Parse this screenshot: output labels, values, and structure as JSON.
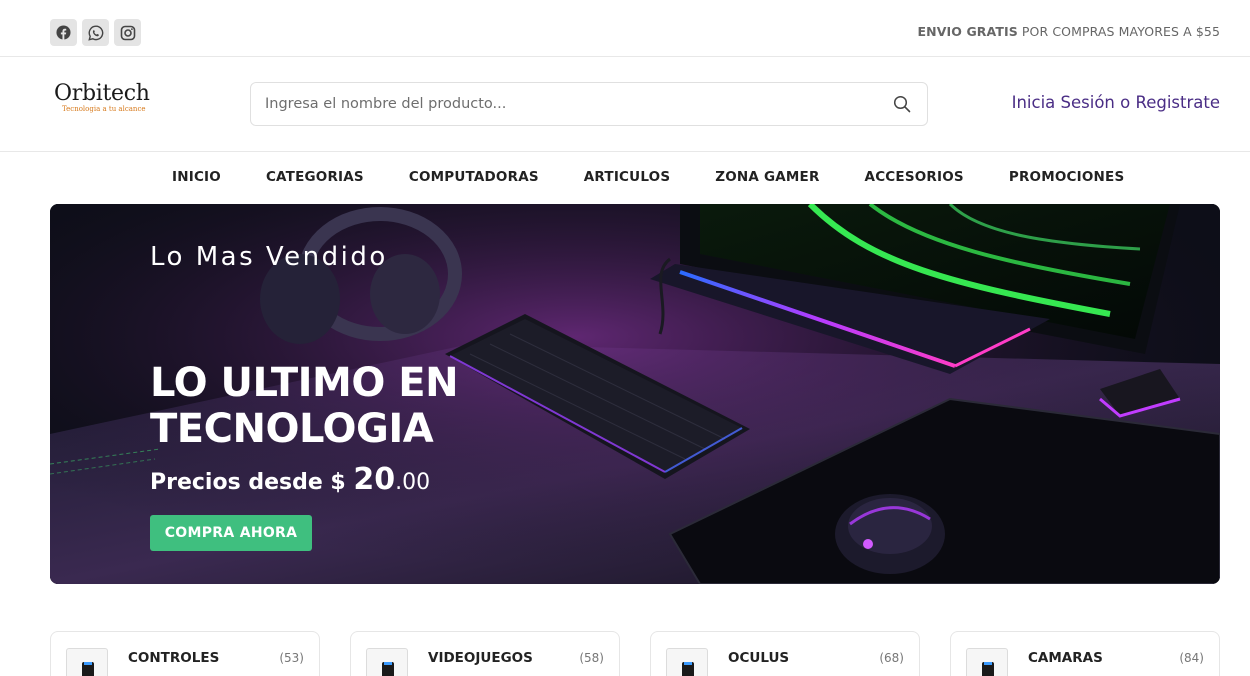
{
  "topbar": {
    "social": [
      {
        "name": "facebook-icon"
      },
      {
        "name": "whatsapp-icon"
      },
      {
        "name": "instagram-icon"
      }
    ],
    "promo_bold": "ENVIO GRATIS",
    "promo_rest": " POR COMPRAS MAYORES A $55"
  },
  "header": {
    "logo_text": "Orbitech",
    "logo_tagline": "Tecnologia a tu alcance",
    "search_placeholder": "Ingresa el nombre del producto...",
    "login_label": "Inicia Sesión o Registrate"
  },
  "nav": {
    "items": [
      "INICIO",
      "CATEGORIAS",
      "COMPUTADORAS",
      "ARTICULOS",
      "ZONA GAMER",
      "ACCESORIOS",
      "PROMOCIONES"
    ]
  },
  "hero": {
    "subtitle": "Lo Mas Vendido",
    "title_line1": "LO ULTIMO EN",
    "title_line2": "TECNOLOGIA",
    "price_prefix": "Precios desde $ ",
    "price_whole": "20",
    "price_cents": ".00",
    "cta_label": "COMPRA AHORA"
  },
  "categories": [
    {
      "name": "CONTROLES",
      "count": "(53)"
    },
    {
      "name": "VIDEOJUEGOS",
      "count": "(58)"
    },
    {
      "name": "OCULUS",
      "count": "(68)"
    },
    {
      "name": "CAMARAS",
      "count": "(84)"
    }
  ],
  "colors": {
    "accent_green": "#3fbf7f",
    "login_purple": "#4a2d85",
    "logo_orange": "#d77a1c"
  }
}
